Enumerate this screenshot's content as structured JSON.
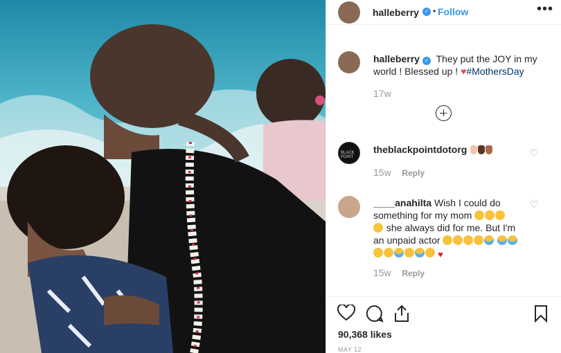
{
  "post": {
    "username": "halleberry",
    "verified_icon": "verified-badge-icon",
    "follow_label": "Follow",
    "separator": "•",
    "more_label": "•••"
  },
  "caption": {
    "username": "halleberry",
    "text_before": "They put the JOY in my world !  Blessed up !",
    "heart": "♥",
    "hashtag": "#MothersDay",
    "time": "17w"
  },
  "comments": [
    {
      "username": "theblackpointdotorg",
      "avatar_text": "BLACK POINT",
      "skin_emoji_colors": [
        "#f2c4a8",
        "#7a4b33",
        "#a86b45"
      ],
      "time": "15w",
      "reply_label": "Reply"
    },
    {
      "username": "____anahilta",
      "text_1": "Wish I could do something for my mom",
      "text_2": "she always did for me. But I'm an unpaid actor",
      "heart": "♥",
      "time": "15w",
      "reply_label": "Reply"
    }
  ],
  "footer": {
    "likes": "90,368 likes",
    "date": "MAY 12"
  },
  "colors": {
    "accent": "#3897f0",
    "heart": "#ed4956",
    "hashtag": "#003569",
    "muted": "#999999"
  }
}
